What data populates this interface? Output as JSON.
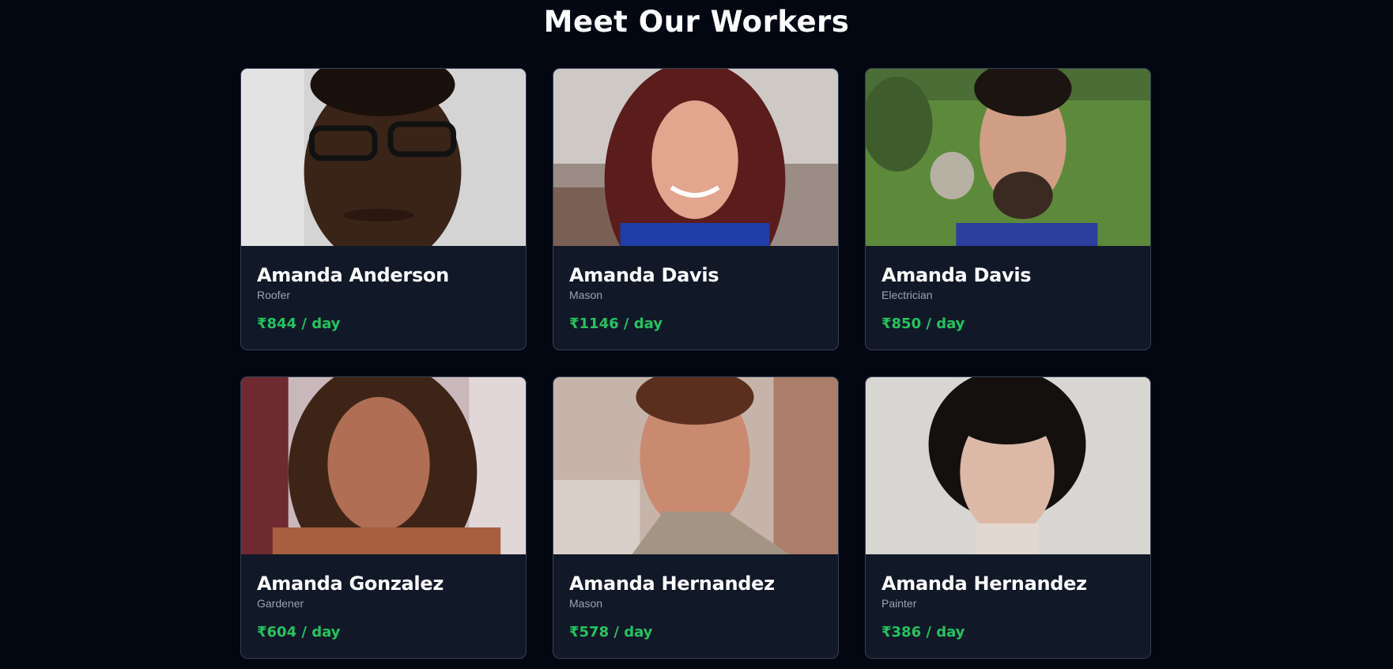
{
  "page": {
    "title": "Meet Our Workers"
  },
  "colors": {
    "background": "#030712",
    "card": "#111827",
    "card_border": "#374151",
    "rate": "#22c55e",
    "role": "#9ca3af"
  },
  "workers": [
    {
      "name": "Amanda Anderson",
      "role": "Roofer",
      "rate": "₹844 / day",
      "photo": "worker-photo"
    },
    {
      "name": "Amanda Davis",
      "role": "Mason",
      "rate": "₹1146 / day",
      "photo": "worker-photo"
    },
    {
      "name": "Amanda Davis",
      "role": "Electrician",
      "rate": "₹850 / day",
      "photo": "worker-photo"
    },
    {
      "name": "Amanda Gonzalez",
      "role": "Gardener",
      "rate": "₹604 / day",
      "photo": "worker-photo"
    },
    {
      "name": "Amanda Hernandez",
      "role": "Mason",
      "rate": "₹578 / day",
      "photo": "worker-photo"
    },
    {
      "name": "Amanda Hernandez",
      "role": "Painter",
      "rate": "₹386 / day",
      "photo": "worker-photo"
    }
  ]
}
